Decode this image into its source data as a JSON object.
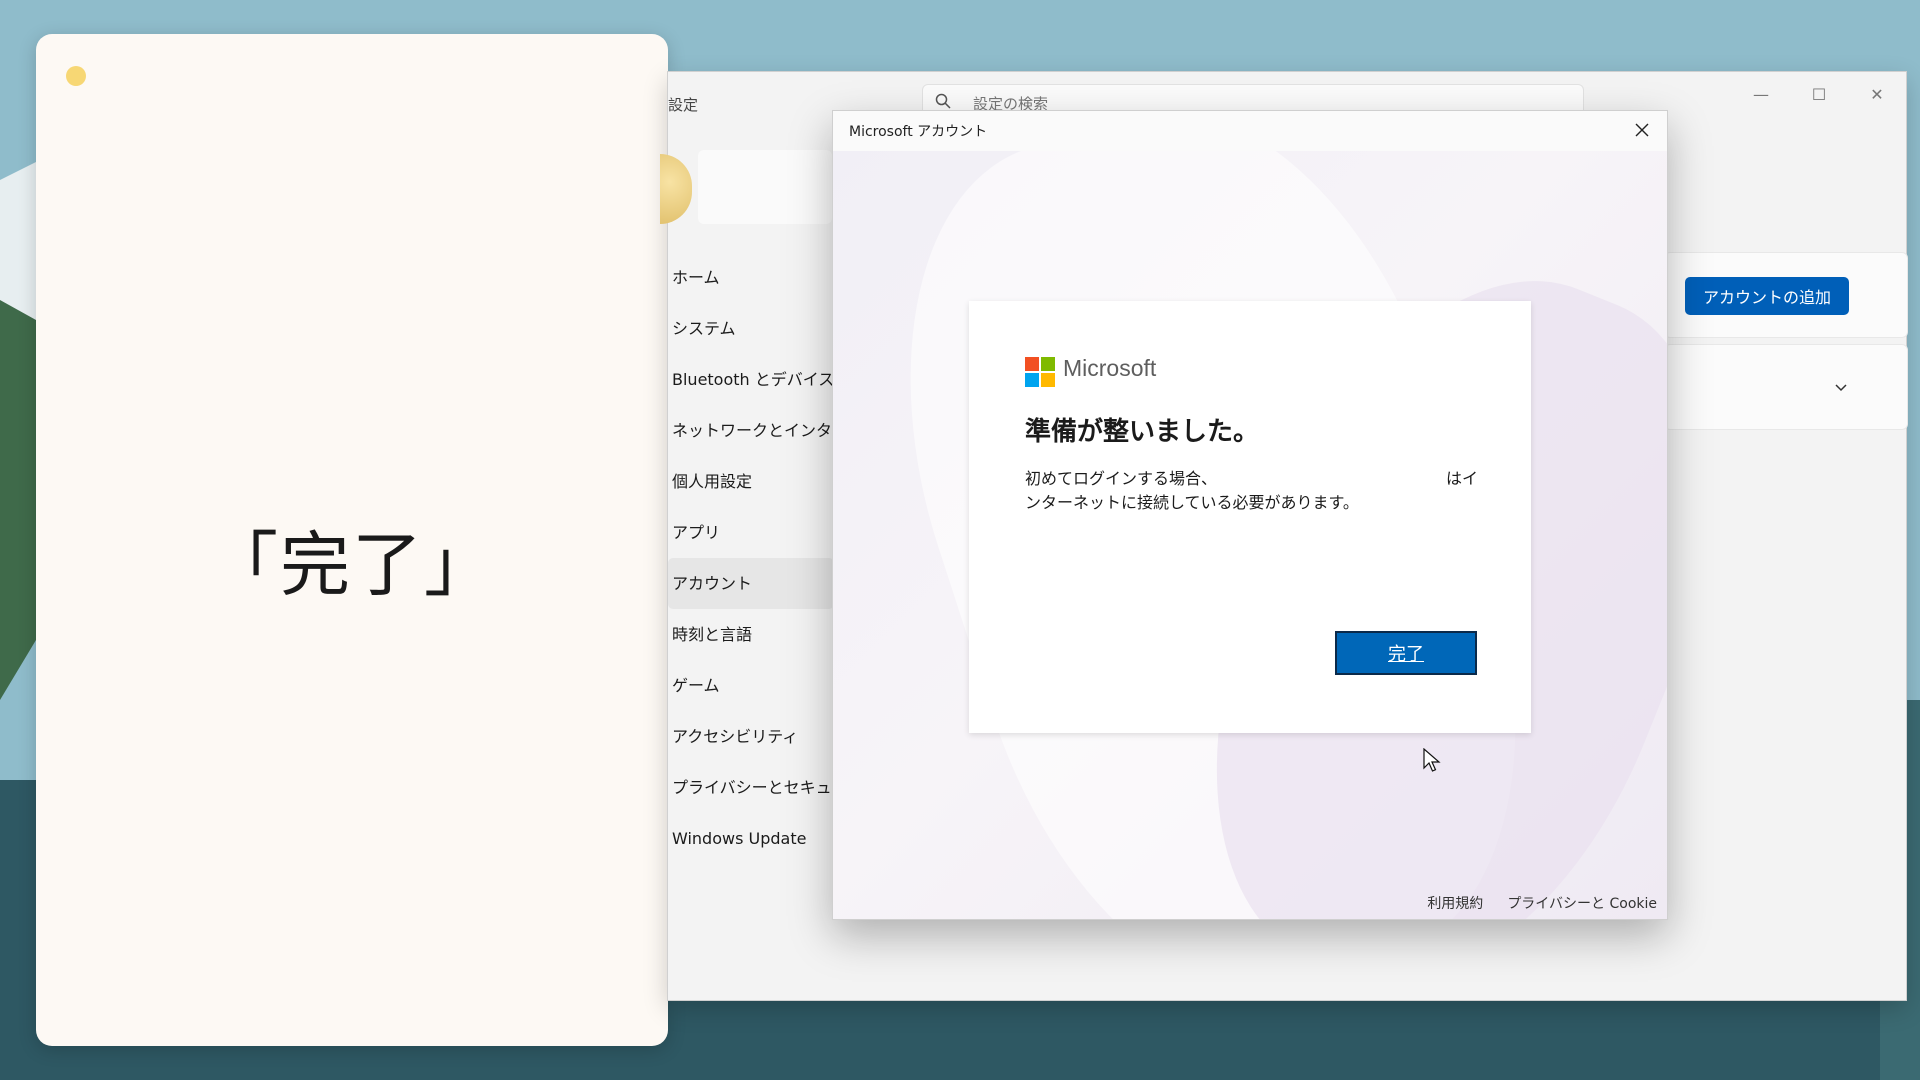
{
  "caption": {
    "text": "「完了」"
  },
  "settings": {
    "title": "設定",
    "search_placeholder": "設定の検索",
    "window_controls": {
      "minimize": "—",
      "maximize": "☐",
      "close": "✕"
    },
    "nav_items": [
      {
        "label": "ホーム"
      },
      {
        "label": "システム"
      },
      {
        "label": "Bluetooth とデバイス"
      },
      {
        "label": "ネットワークとインターネット"
      },
      {
        "label": "個人用設定"
      },
      {
        "label": "アプリ"
      },
      {
        "label": "アカウント",
        "active": true
      },
      {
        "label": "時刻と言語"
      },
      {
        "label": "ゲーム"
      },
      {
        "label": "アクセシビリティ"
      },
      {
        "label": "プライバシーとセキュリティ"
      },
      {
        "label": "Windows Update"
      }
    ],
    "add_account_label": "アカウントの追加"
  },
  "dialog": {
    "title": "Microsoft アカウント",
    "brand": "Microsoft",
    "heading": "準備が整いました。",
    "body_line1": "初めてログインする場合、",
    "body_line1_right": "はイ",
    "body_line2": "ンターネットに接続している必要があります。",
    "done_label": "完了",
    "footer_links": [
      "利用規約",
      "プライバシーと Cookie"
    ]
  },
  "colors": {
    "accent": "#0067b8",
    "logo_red": "#f25022",
    "logo_green": "#7fba00",
    "logo_blue": "#00a4ef",
    "logo_yellow": "#ffb900"
  }
}
